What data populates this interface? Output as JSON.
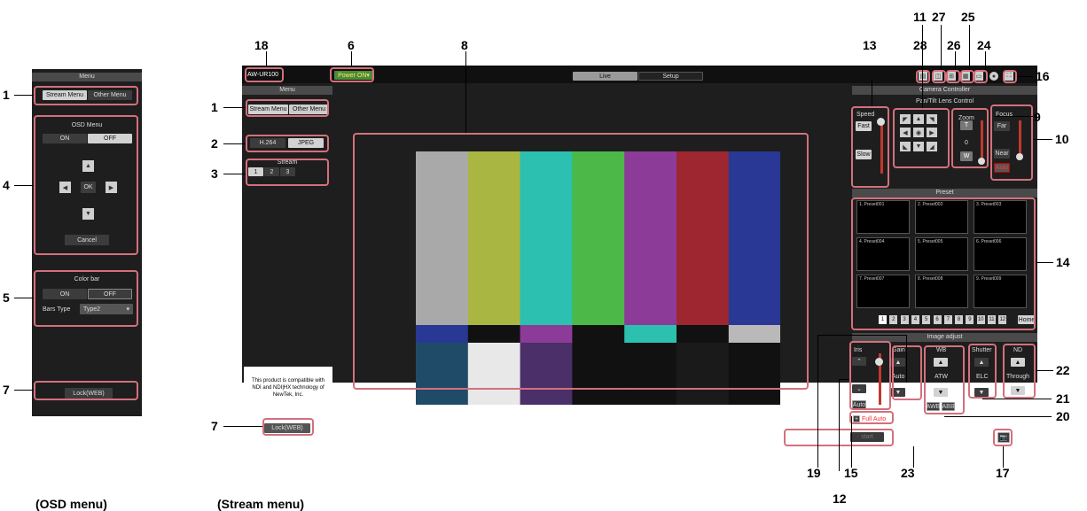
{
  "osd_panel": {
    "title": "Menu",
    "tabs": [
      "Stream Menu",
      "Other Menu"
    ],
    "osd_title": "OSD Menu",
    "on": "ON",
    "off": "OFF",
    "ok": "OK",
    "cancel": "Cancel",
    "colorbar_title": "Color bar",
    "bars_type_label": "Bars Type",
    "bars_type_value": "Type2",
    "lock": "Lock(WEB)"
  },
  "main": {
    "model": "AW-UR100",
    "power": "Power ON",
    "tab_live": "Live",
    "tab_setup": "Setup",
    "menu_title": "Menu",
    "tabs": [
      "Stream Menu",
      "Other Menu"
    ],
    "codec": [
      "H.264",
      "JPEG"
    ],
    "stream_title": "Stream",
    "streams": [
      "1",
      "2",
      "3"
    ],
    "ndi_notice": "This product is compatible with NDI and NDI|HX technology of NewTek, Inc.",
    "lock": "Lock(WEB)"
  },
  "controller": {
    "title": "Camera Controller",
    "pantilt_title": "Pan/Tilt Lens Control",
    "speed": "Speed",
    "fast": "Fast",
    "slow": "Slow",
    "zoom": "Zoom",
    "zoom_t": "T",
    "zoom_val": "0",
    "zoom_w": "W",
    "focus": "Focus",
    "far": "Far",
    "near": "Near",
    "auto": "Auto",
    "preset_title": "Preset",
    "presets": [
      "Preset001",
      "Preset002",
      "Preset003",
      "Preset004",
      "Preset005",
      "Preset006",
      "Preset007",
      "Preset008",
      "Preset009"
    ],
    "preset_nums": [
      "1",
      "2",
      "3",
      "4",
      "5",
      "6",
      "7",
      "8",
      "9"
    ],
    "pages": [
      "1",
      "2",
      "3",
      "4",
      "5",
      "6",
      "7",
      "8",
      "9",
      "10",
      "11",
      "12"
    ],
    "home": "Home",
    "image_adjust_title": "Image adjust",
    "iris": "Iris",
    "iris_auto": "Auto",
    "gain": "Gain",
    "gain_val": "Auto",
    "wb": "WB",
    "wb_val": "ATW",
    "awb": "AWB",
    "abb": "ABB",
    "shutter": "Shutter",
    "shutter_val": "ELC",
    "nd": "ND",
    "nd_val": "Through",
    "full_auto": "Full Auto",
    "stream_proto": "SRT/MPEG-TS/RTMP",
    "start": "start"
  },
  "callouts": {
    "c1a": "1",
    "c4": "4",
    "c5": "5",
    "c7a": "7",
    "c18": "18",
    "c6": "6",
    "c8": "8",
    "c1b": "1",
    "c2": "2",
    "c3": "3",
    "c7b": "7",
    "c13": "13",
    "c11": "11",
    "c28": "28",
    "c27": "27",
    "c26": "26",
    "c25": "25",
    "c24": "24",
    "c16": "16",
    "c9": "9",
    "c10": "10",
    "c14": "14",
    "c22": "22",
    "c21": "21",
    "c20": "20",
    "c19": "19",
    "c15": "15",
    "c23": "23",
    "c17": "17",
    "c12": "12"
  },
  "captions": {
    "osd": "(OSD menu)",
    "stream": "(Stream menu)"
  },
  "colorbar": {
    "top": [
      "#a9a9a9",
      "#aab642",
      "#2cc0b0",
      "#4bb847",
      "#8c3b99",
      "#9e2631",
      "#283894"
    ],
    "mid": [
      "#283894",
      "#111111",
      "#8c3b99",
      "#111111",
      "#2cc0b0",
      "#111111",
      "#b9b9b9"
    ],
    "bottom": [
      "#204b68",
      "#e8e8e8",
      "#4a2f68",
      "#111111",
      "#111111",
      "#1a1a1a",
      "#111111"
    ]
  }
}
